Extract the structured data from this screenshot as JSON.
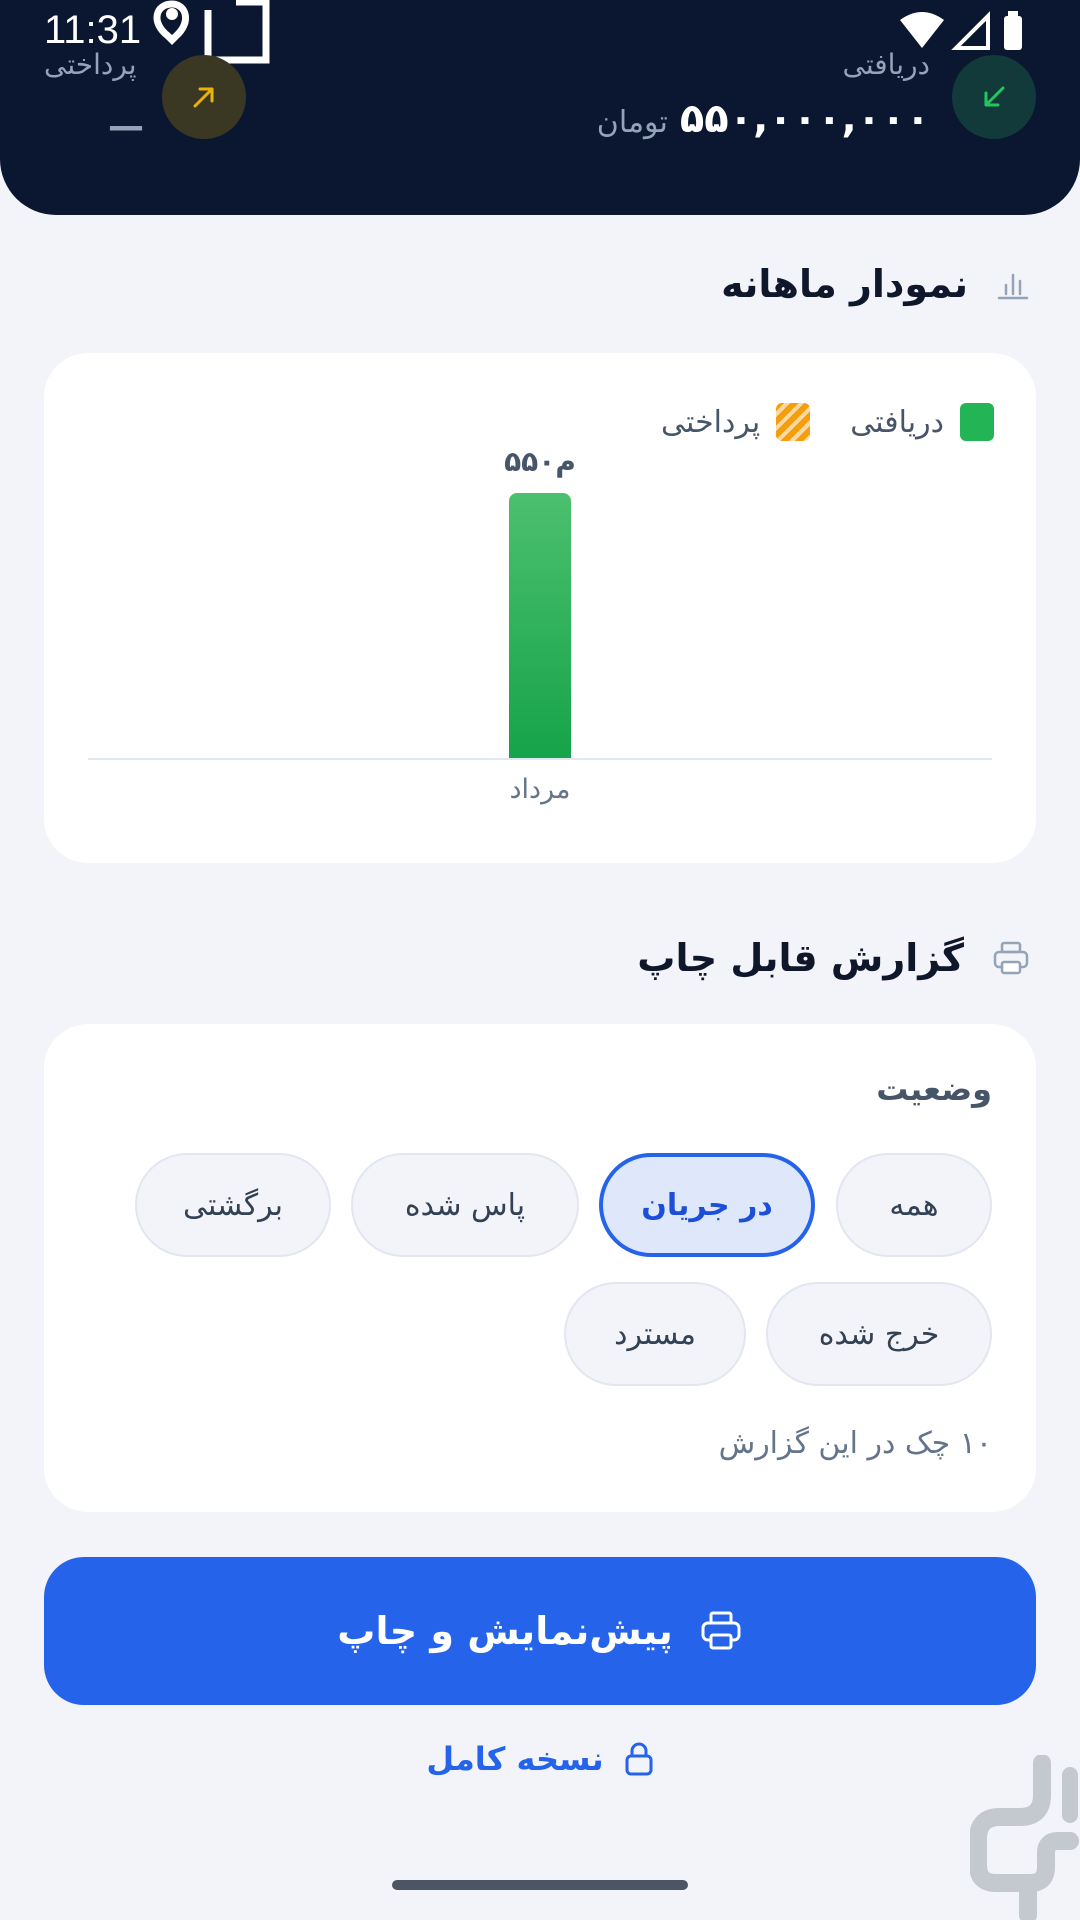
{
  "status_bar": {
    "time": "11:31"
  },
  "header": {
    "received_label": "دریافتی",
    "received_amount": "۵۵۰,۰۰۰,۰۰۰",
    "received_unit": "تومان",
    "paid_label": "پرداختی",
    "paid_amount": "—"
  },
  "monthly_chart": {
    "title": "نمودار ماهانه",
    "legend": {
      "received": "دریافتی",
      "paid": "پرداختی"
    }
  },
  "chart_data": {
    "type": "bar",
    "categories": [
      "مرداد"
    ],
    "series": [
      {
        "name": "دریافتی",
        "values": [
          550
        ],
        "color": "#22b455"
      },
      {
        "name": "پرداختی",
        "values": [
          0
        ],
        "color": "#f59e0b"
      }
    ],
    "data_labels": [
      "۵۵۰م"
    ],
    "legend_position": "top-right",
    "grid": false
  },
  "report": {
    "title": "گزارش قابل چاپ",
    "status_label": "وضعیت",
    "chips": {
      "all": "همه",
      "in_progress": "در جریان",
      "passed": "پاس شده",
      "returned": "برگشتی",
      "spent": "خرج شده",
      "refunded": "مسترد"
    },
    "selected_chip": "در جریان",
    "count_text": "۱۰ چک در این گزارش"
  },
  "actions": {
    "print_preview": "پیش‌نمایش و چاپ",
    "full_version": "نسخه کامل"
  },
  "colors": {
    "header_bg": "#0b1730",
    "accent": "#2563eb",
    "received": "#22b455",
    "paid": "#f59e0b"
  },
  "icons": {
    "received": "arrow-down-left-icon",
    "paid": "arrow-up-right-icon",
    "chart": "bar-chart-icon",
    "print": "printer-icon",
    "lock": "lock-icon"
  }
}
